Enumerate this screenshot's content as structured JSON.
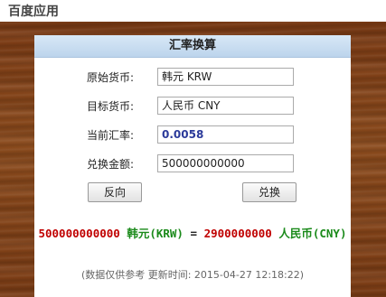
{
  "app": {
    "title": "百度应用"
  },
  "panel": {
    "title": "汇率换算"
  },
  "form": {
    "source_label": "原始货币:",
    "source_value": "韩元 KRW",
    "target_label": "目标货币:",
    "target_value": "人民币 CNY",
    "rate_label": "当前汇率:",
    "rate_value": "0.0058",
    "amount_label": "兑换金额:",
    "amount_value": "500000000000"
  },
  "buttons": {
    "reverse": "反向",
    "convert": "兑换"
  },
  "result": {
    "from_amount": "500000000000",
    "from_currency": "韩元(KRW)",
    "equals": "=",
    "to_amount": "2900000000",
    "to_currency": "人民币(CNY)"
  },
  "footer": {
    "note": "(数据仅供参考 更新时间: 2015-04-27 12:18:22)"
  },
  "colors": {
    "wood": "#7d3d16",
    "header": "#c4daef",
    "result_amount": "#c00000",
    "result_currency": "#1a8a1a",
    "rate_text": "#2b3a9a"
  }
}
